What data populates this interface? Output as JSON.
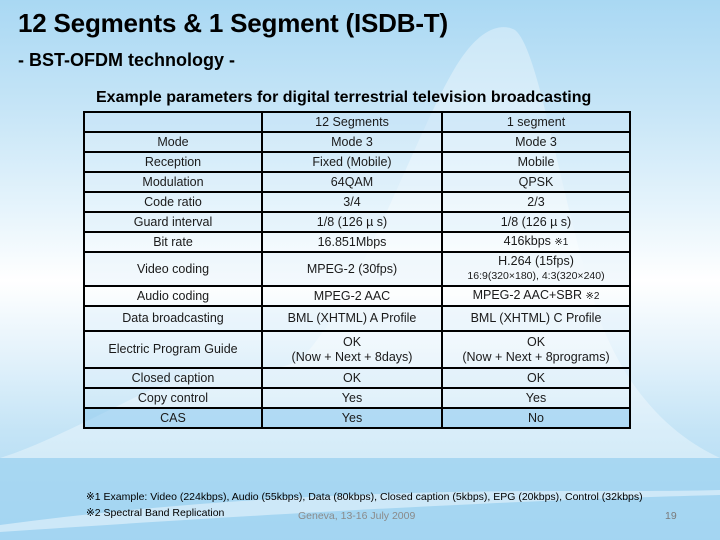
{
  "slide": {
    "title": "12 Segments & 1 Segment (ISDB-T)",
    "subtitle": "- BST-OFDM technology -",
    "caption": "Example parameters for digital terrestrial television broadcasting"
  },
  "table": {
    "headers": [
      "",
      "12 Segments",
      "1 segment"
    ],
    "rows": [
      {
        "label": "Mode",
        "seg12": "Mode 3",
        "seg1": "Mode 3"
      },
      {
        "label": "Reception",
        "seg12": "Fixed (Mobile)",
        "seg1": "Mobile"
      },
      {
        "label": "Modulation",
        "seg12": "64QAM",
        "seg1": "QPSK"
      },
      {
        "label": "Code ratio",
        "seg12": "3/4",
        "seg1": "2/3"
      },
      {
        "label": "Guard interval",
        "seg12": "1/8 (126 µ s)",
        "seg1": "1/8 (126 µ s)"
      },
      {
        "label": "Bit rate",
        "seg12": "16.851Mbps",
        "seg1": "416kbps",
        "seg1_note": "※1"
      },
      {
        "label": "Video coding",
        "seg12": "MPEG-2 (30fps)",
        "seg1": "H.264 (15fps)",
        "seg1_line2": "16:9(320×180), 4:3(320×240)"
      },
      {
        "label": "Audio coding",
        "seg12": "MPEG-2 AAC",
        "seg1": "MPEG-2 AAC+SBR",
        "seg1_note": "※2"
      },
      {
        "label": "Data broadcasting",
        "seg12": "BML (XHTML) A Profile",
        "seg1": "BML (XHTML) C Profile"
      },
      {
        "label": "Electric Program Guide",
        "seg12": "OK",
        "seg12_line2": "(Now + Next + 8days)",
        "seg1": "OK",
        "seg1_line2": "(Now + Next + 8programs)"
      },
      {
        "label": "Closed caption",
        "seg12": "OK",
        "seg1": "OK"
      },
      {
        "label": "Copy control",
        "seg12": "Yes",
        "seg1": "Yes"
      },
      {
        "label": "CAS",
        "seg12": "Yes",
        "seg1": "No"
      }
    ]
  },
  "notes": [
    "※1 Example: Video (224kbps), Audio (55kbps), Data (80kbps), Closed caption (5kbps), EPG (20kbps), Control (32kbps)",
    "※2 Spectral Band Replication"
  ],
  "footer": {
    "date": "Geneva, 13-16 July 2009",
    "page": "19"
  }
}
